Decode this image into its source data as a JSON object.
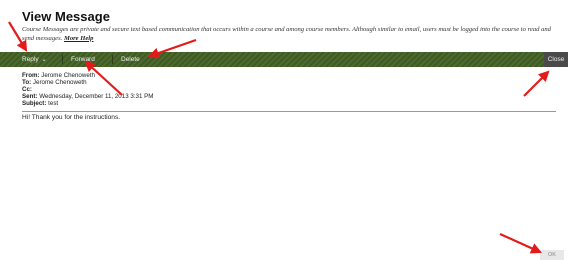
{
  "page": {
    "title": "View Message",
    "description": "Course Messages are private and secure text based communication that occurs within a course and among course members. Although similar to email, users must be logged into the course to read and send messages.",
    "help_link": "More Help"
  },
  "toolbar": {
    "reply_label": "Reply",
    "forward_label": "Forward",
    "delete_label": "Delete",
    "close_label": "Close"
  },
  "message": {
    "from_label": "From:",
    "from_value": "Jerome Chenoweth",
    "to_label": "To:",
    "to_value": "Jerome Chenoweth",
    "cc_label": "Cc:",
    "cc_value": "",
    "sent_label": "Sent:",
    "sent_value": "Wednesday, December 11, 2013 3:31 PM",
    "subject_label": "Subject:",
    "subject_value": "test",
    "body": "Hi! Thank you for the instructions."
  },
  "footer": {
    "ok_label": "OK"
  },
  "colors": {
    "toolbar_bg": "#4c6a2d",
    "close_bg": "#4a4a4a",
    "annotation_arrow": "#e31b1b"
  }
}
